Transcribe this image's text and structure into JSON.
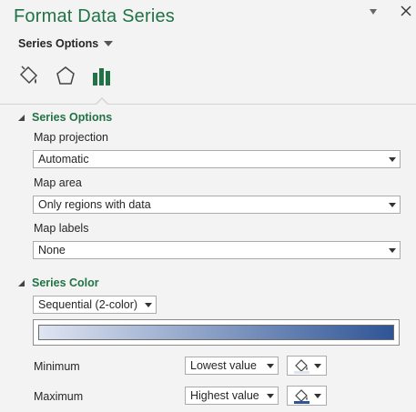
{
  "pane": {
    "title": "Format Data Series",
    "options_menu_label": "Series Options"
  },
  "tabs": [
    {
      "icon": "fill-line-icon"
    },
    {
      "icon": "effects-pentagon-icon"
    },
    {
      "icon": "series-options-bar-chart-icon",
      "active": true
    }
  ],
  "series_options": {
    "header": "Series Options",
    "map_projection": {
      "label": "Map projection",
      "value": "Automatic"
    },
    "map_area": {
      "label": "Map area",
      "value": "Only regions with data"
    },
    "map_labels": {
      "label": "Map labels",
      "value": "None"
    }
  },
  "series_color": {
    "header": "Series Color",
    "scheme": "Sequential (2-color)",
    "gradient_start": "#dfe5f1",
    "gradient_end": "#2f5597",
    "minimum": {
      "label": "Minimum",
      "value": "Lowest value",
      "color": "#dfe5f1"
    },
    "maximum": {
      "label": "Maximum",
      "value": "Highest value",
      "color": "#2f5597"
    }
  },
  "colors": {
    "accent": "#217346"
  }
}
